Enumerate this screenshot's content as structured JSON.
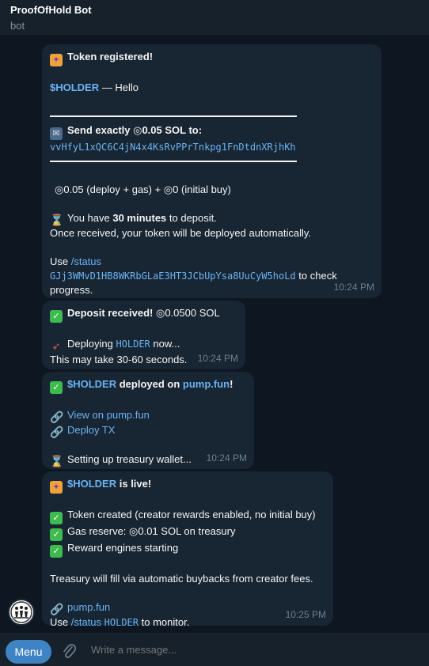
{
  "header": {
    "title": "ProofOfHold Bot",
    "subtitle": "bot"
  },
  "messages": [
    {
      "lines": {
        "registered": "Token registered!",
        "ticker": "$HOLDER",
        "hello": " — Hello",
        "send_exactly": "Send exactly ◎0.05 SOL to:",
        "address": "vvHfyL1xQC6C4jN4x4KsRvPPrTnkpg1FnDtdnXRjhKh",
        "cost": "◎0.05 (deploy + gas) + ◎0 (initial buy)",
        "you_have": "You have ",
        "minutes": "30 minutes",
        "to_deposit": " to deposit.",
        "once_received": "Once received, your token will be deployed automatically.",
        "use": "Use ",
        "status_cmd": "/status",
        "status_id": "GJj3WMvD1HB8WKRbGLaE3HT3JCbUpYsa8UuCyW5hoLd",
        "to_check": " to check",
        "progress": "progress."
      },
      "time": "10:24 PM"
    },
    {
      "lines": {
        "deposit_received": "Deposit received!",
        "amount": " ◎0.0500 SOL",
        "deploying": "Deploying ",
        "ticker": "HOLDER",
        "now": " now...",
        "may_take": "This may take 30-60 seconds."
      },
      "time": "10:24 PM"
    },
    {
      "lines": {
        "ticker": "$HOLDER",
        "deployed_on": " deployed on ",
        "pump": "pump.fun",
        "bang": "!",
        "view": "View on pump.fun",
        "deploy_tx": "Deploy TX",
        "setting_up": "Setting up treasury wallet..."
      },
      "time": "10:24 PM"
    },
    {
      "lines": {
        "ticker": "$HOLDER",
        "is_live": " is live!",
        "token_created": "Token created (creator rewards enabled, no initial buy)",
        "gas_reserve": "Gas reserve: ◎0.01 SOL on treasury",
        "reward_engines": "Reward engines starting",
        "treasury_fill": "Treasury will fill via automatic buybacks from creator fees.",
        "pump_link": "pump.fun",
        "use": "Use ",
        "status_cmd": "/status",
        "holder": "HOLDER",
        "to_monitor": " to monitor."
      },
      "time": "10:25 PM"
    }
  ],
  "footer": {
    "menu_label": "Menu",
    "input_placeholder": "Write a message..."
  },
  "icons": {
    "party": "party-popper-icon",
    "mailbox": "mailbox-icon",
    "hourglass": "hourglass-icon",
    "check": "check-mark-icon",
    "rocket": "rocket-icon",
    "link": "link-icon"
  },
  "colors": {
    "accent": "#6ab3f3",
    "bubble": "#182533",
    "background": "#0e1621",
    "menu_button": "#3e83c4"
  }
}
